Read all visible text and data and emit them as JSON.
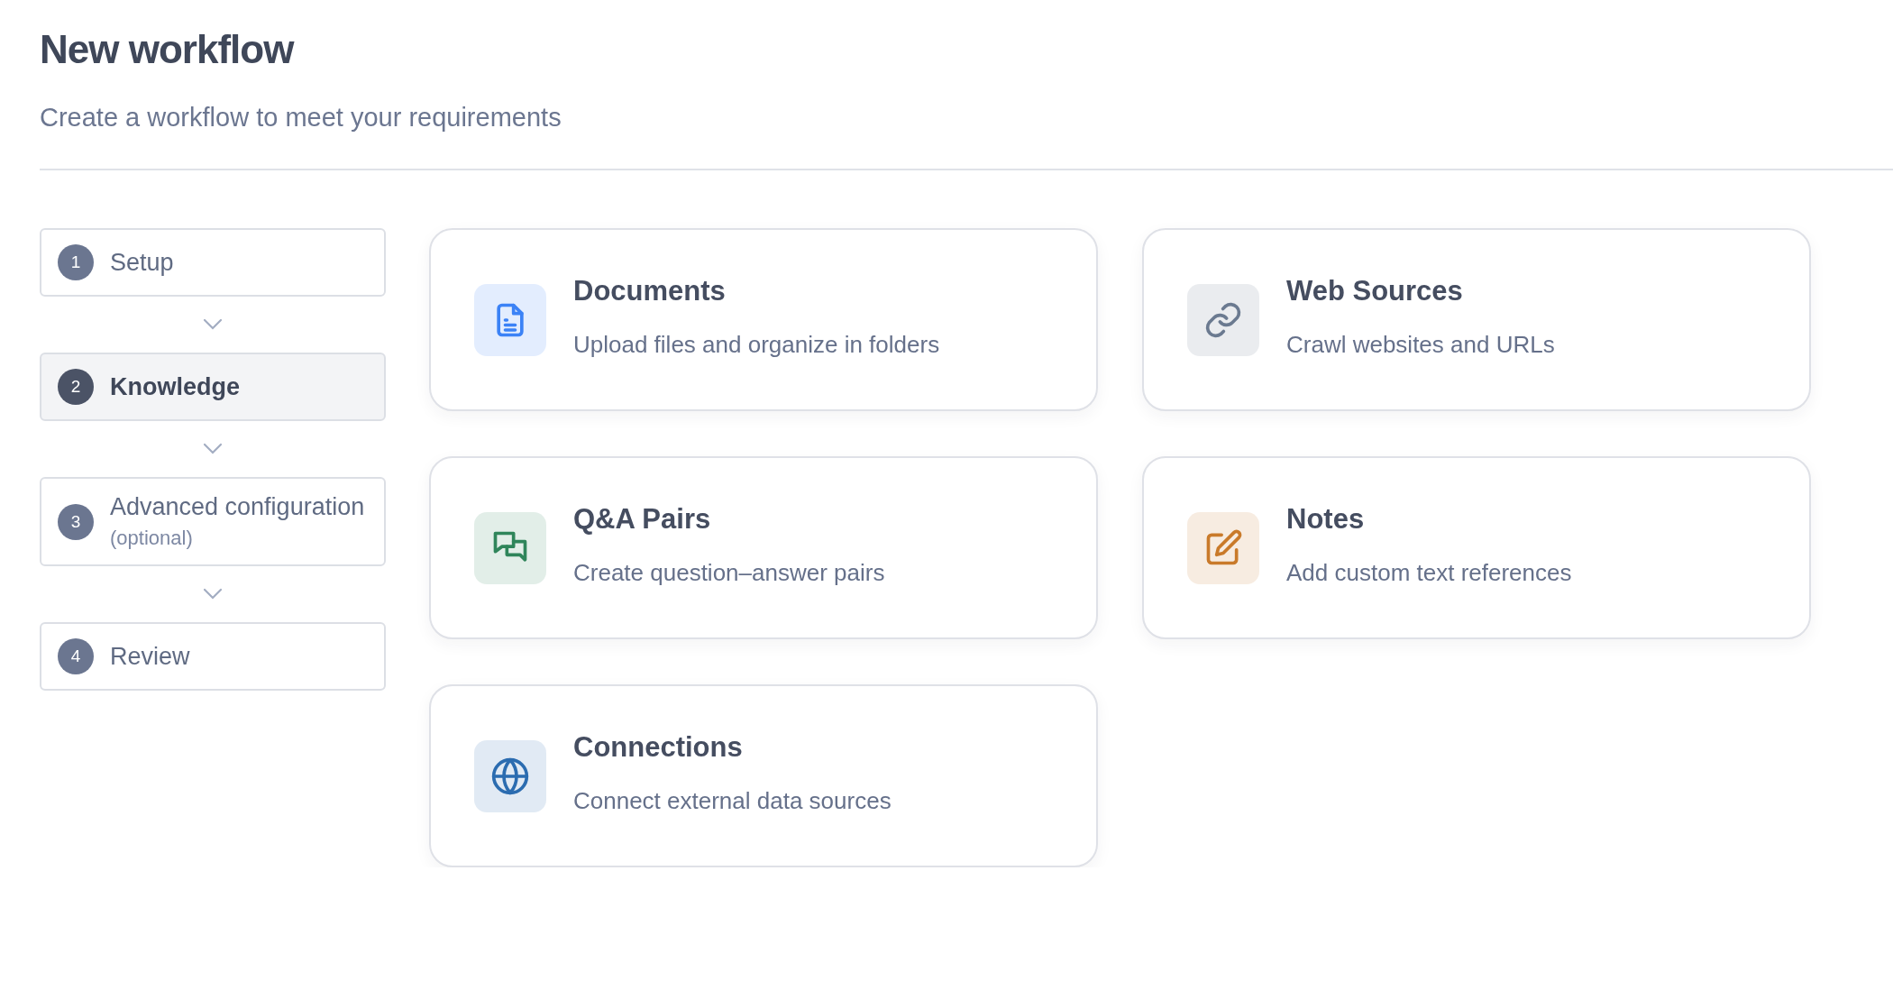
{
  "header": {
    "title": "New workflow",
    "subtitle": "Create a workflow to meet your requirements"
  },
  "steps": [
    {
      "number": "1",
      "label": "Setup",
      "selected": false
    },
    {
      "number": "2",
      "label": "Knowledge",
      "selected": true
    },
    {
      "number": "3",
      "label": "Advanced configuration",
      "note": "(optional)",
      "selected": false
    },
    {
      "number": "4",
      "label": "Review",
      "selected": false
    }
  ],
  "sources": [
    {
      "kind": "document",
      "title": "Documents",
      "description": "Upload files and organize in folders",
      "color": "#3b82f6"
    },
    {
      "kind": "link",
      "title": "Web Sources",
      "description": "Crawl websites and URLs",
      "color": "#6b7a90"
    },
    {
      "kind": "chat",
      "title": "Q&A Pairs",
      "description": "Create question–answer pairs",
      "color": "#2f855a"
    },
    {
      "kind": "edit",
      "title": "Notes",
      "description": "Add custom text references",
      "color": "#c97a2a"
    },
    {
      "kind": "globe",
      "title": "Connections",
      "description": "Connect external data sources",
      "color": "#2b6cb0"
    }
  ]
}
